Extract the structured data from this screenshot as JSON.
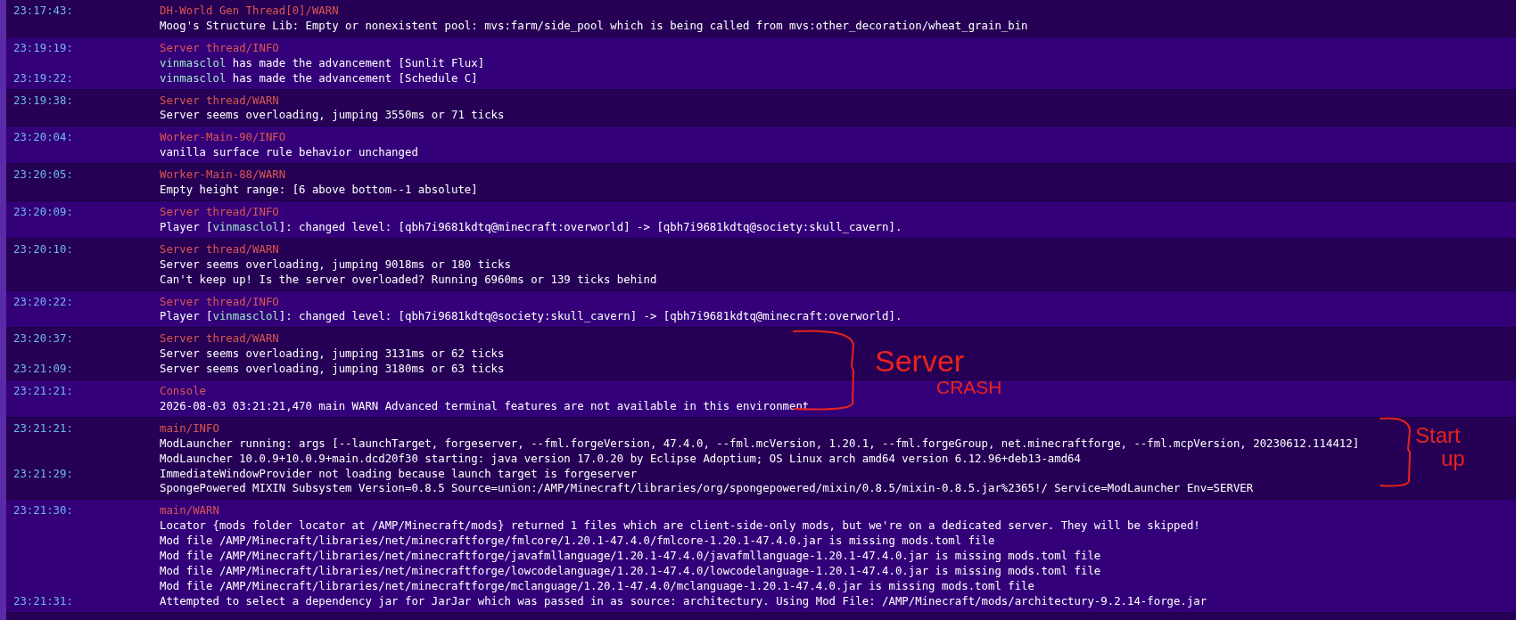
{
  "log": [
    {
      "source": "DH-World Gen Thread[0]/WARN",
      "lines": [
        {
          "time": "23:17:43:",
          "segments": [
            {
              "kind": "plain",
              "text": "Moog's Structure Lib: Empty or nonexistent pool: mvs:farm/side_pool which is being called from mvs:other_decoration/wheat_grain_bin"
            }
          ]
        }
      ]
    },
    {
      "source": "Server thread/INFO",
      "lines": [
        {
          "time": "23:19:19:",
          "segments": [
            {
              "kind": "player",
              "text": "vinmasclol"
            },
            {
              "kind": "plain",
              "text": " has made the advancement [Sunlit Flux]"
            }
          ]
        },
        {
          "time": "23:19:22:",
          "segments": [
            {
              "kind": "player",
              "text": "vinmasclol"
            },
            {
              "kind": "plain",
              "text": " has made the advancement [Schedule C]"
            }
          ]
        }
      ]
    },
    {
      "source": "Server thread/WARN",
      "lines": [
        {
          "time": "23:19:38:",
          "segments": [
            {
              "kind": "plain",
              "text": "Server seems overloading, jumping 3550ms or 71 ticks"
            }
          ]
        }
      ]
    },
    {
      "source": "Worker-Main-90/INFO",
      "lines": [
        {
          "time": "23:20:04:",
          "segments": [
            {
              "kind": "plain",
              "text": "vanilla surface rule behavior unchanged"
            }
          ]
        }
      ]
    },
    {
      "source": "Worker-Main-88/WARN",
      "lines": [
        {
          "time": "23:20:05:",
          "segments": [
            {
              "kind": "plain",
              "text": "Empty height range: [6 above bottom--1 absolute]"
            }
          ]
        }
      ]
    },
    {
      "source": "Server thread/INFO",
      "lines": [
        {
          "time": "23:20:09:",
          "segments": [
            {
              "kind": "plain",
              "text": "Player ["
            },
            {
              "kind": "player",
              "text": "vinmasclol"
            },
            {
              "kind": "plain",
              "text": "]: changed level: [qbh7i9681kdtq@minecraft:overworld] -> [qbh7i9681kdtq@society:skull_cavern]."
            }
          ]
        }
      ]
    },
    {
      "source": "Server thread/WARN",
      "lines": [
        {
          "time": "23:20:10:",
          "segments": [
            {
              "kind": "plain",
              "text": "Server seems overloading, jumping 9018ms or 180 ticks"
            }
          ]
        },
        {
          "segments": [
            {
              "kind": "plain",
              "text": "Can't keep up! Is the server overloaded? Running 6960ms or 139 ticks behind"
            }
          ]
        }
      ]
    },
    {
      "source": "Server thread/INFO",
      "lines": [
        {
          "time": "23:20:22:",
          "segments": [
            {
              "kind": "plain",
              "text": "Player ["
            },
            {
              "kind": "player",
              "text": "vinmasclol"
            },
            {
              "kind": "plain",
              "text": "]: changed level: [qbh7i9681kdtq@society:skull_cavern] -> [qbh7i9681kdtq@minecraft:overworld]."
            }
          ]
        }
      ]
    },
    {
      "source": "Server thread/WARN",
      "lines": [
        {
          "time": "23:20:37:",
          "segments": [
            {
              "kind": "plain",
              "text": "Server seems overloading, jumping 3131ms or 62 ticks"
            }
          ]
        },
        {
          "time": "23:21:09:",
          "segments": [
            {
              "kind": "plain",
              "text": "Server seems overloading, jumping 3180ms or 63 ticks"
            }
          ]
        }
      ]
    },
    {
      "source": "Console",
      "lines": [
        {
          "time": "23:21:21:",
          "segments": [
            {
              "kind": "plain",
              "text": "2026-08-03 03:21:21,470 main WARN Advanced terminal features are not available in this environment"
            }
          ]
        }
      ]
    },
    {
      "source": "main/INFO",
      "lines": [
        {
          "time": "23:21:21:",
          "segments": [
            {
              "kind": "plain",
              "text": "ModLauncher running: args [--launchTarget, forgeserver, --fml.forgeVersion, 47.4.0, --fml.mcVersion, 1.20.1, --fml.forgeGroup, net.minecraftforge, --fml.mcpVersion, 20230612.114412]"
            }
          ]
        },
        {
          "segments": [
            {
              "kind": "plain",
              "text": "ModLauncher 10.0.9+10.0.9+main.dcd20f30 starting: java version 17.0.20 by Eclipse Adoptium; OS Linux arch amd64 version 6.12.96+deb13-amd64"
            }
          ]
        },
        {
          "time": "23:21:29:",
          "segments": [
            {
              "kind": "plain",
              "text": "ImmediateWindowProvider not loading because launch target is forgeserver"
            }
          ]
        },
        {
          "segments": [
            {
              "kind": "plain",
              "text": "SpongePowered MIXIN Subsystem Version=0.8.5 Source=union:/AMP/Minecraft/libraries/org/spongepowered/mixin/0.8.5/mixin-0.8.5.jar%2365!/ Service=ModLauncher Env=SERVER"
            }
          ]
        }
      ]
    },
    {
      "source": "main/WARN",
      "lines": [
        {
          "time": "23:21:30:",
          "segments": [
            {
              "kind": "plain",
              "text": "Locator {mods folder locator at /AMP/Minecraft/mods} returned 1 files which are client-side-only mods, but we're on a dedicated server. They will be skipped!"
            }
          ]
        },
        {
          "segments": [
            {
              "kind": "plain",
              "text": "Mod file /AMP/Minecraft/libraries/net/minecraftforge/fmlcore/1.20.1-47.4.0/fmlcore-1.20.1-47.4.0.jar is missing mods.toml file"
            }
          ]
        },
        {
          "segments": [
            {
              "kind": "plain",
              "text": "Mod file /AMP/Minecraft/libraries/net/minecraftforge/javafmllanguage/1.20.1-47.4.0/javafmllanguage-1.20.1-47.4.0.jar is missing mods.toml file"
            }
          ]
        },
        {
          "segments": [
            {
              "kind": "plain",
              "text": "Mod file /AMP/Minecraft/libraries/net/minecraftforge/lowcodelanguage/1.20.1-47.4.0/lowcodelanguage-1.20.1-47.4.0.jar is missing mods.toml file"
            }
          ]
        },
        {
          "segments": [
            {
              "kind": "plain",
              "text": "Mod file /AMP/Minecraft/libraries/net/minecraftforge/mclanguage/1.20.1-47.4.0/mclanguage-1.20.1-47.4.0.jar is missing mods.toml file"
            }
          ]
        },
        {
          "time": "23:21:31:",
          "segments": [
            {
              "kind": "plain",
              "text": "Attempted to select a dependency jar for JarJar which was passed in as source: architectury. Using Mod File: /AMP/Minecraft/mods/architectury-9.2.14-forge.jar"
            }
          ]
        }
      ]
    }
  ],
  "annotations": [
    {
      "lines": [
        "Server",
        "CRASH"
      ]
    },
    {
      "lines": [
        "Start",
        "up"
      ]
    }
  ]
}
